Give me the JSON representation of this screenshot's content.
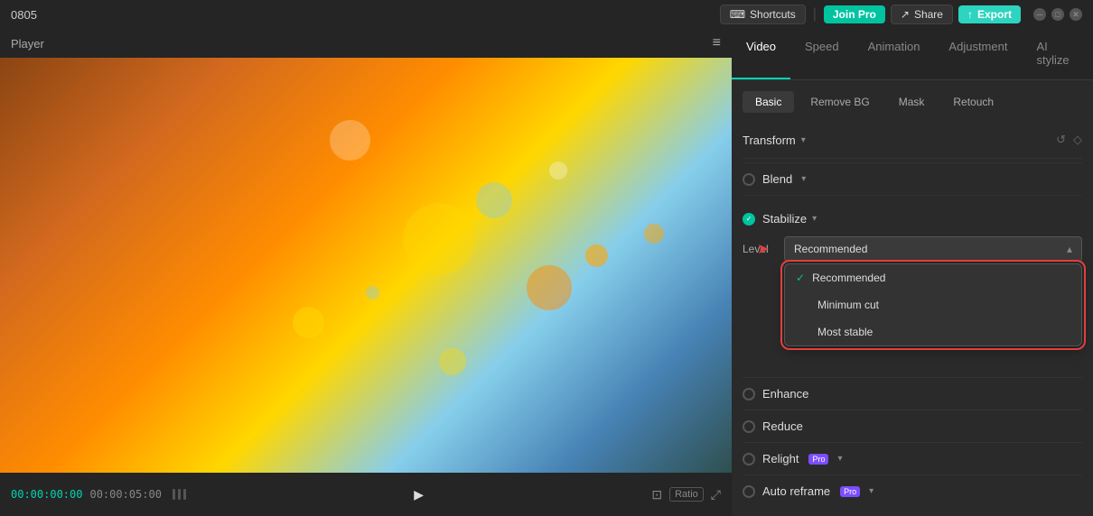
{
  "titlebar": {
    "title": "0805",
    "shortcuts_label": "Shortcuts",
    "joinpro_label": "Join Pro",
    "share_label": "Share",
    "export_label": "Export"
  },
  "player": {
    "label": "Player",
    "time_current": "00:00:00:00",
    "time_total": "00:00:05:00"
  },
  "right_panel": {
    "tabs": [
      "Video",
      "Speed",
      "Animation",
      "Adjustment",
      "AI stylize"
    ],
    "active_tab": "Video",
    "sub_tabs": [
      "Basic",
      "Remove BG",
      "Mask",
      "Retouch"
    ],
    "active_sub_tab": "Basic",
    "transform_label": "Transform",
    "blend_label": "Blend",
    "stabilize_label": "Stabilize",
    "level_label": "Level",
    "dropdown_selected": "Recommended",
    "dropdown_options": [
      "Recommended",
      "Minimum cut",
      "Most stable"
    ],
    "enhance_label": "Enhance",
    "reduce_label": "Reduce",
    "relight_label": "Relight",
    "auto_reframe_label": "Auto reframe"
  }
}
